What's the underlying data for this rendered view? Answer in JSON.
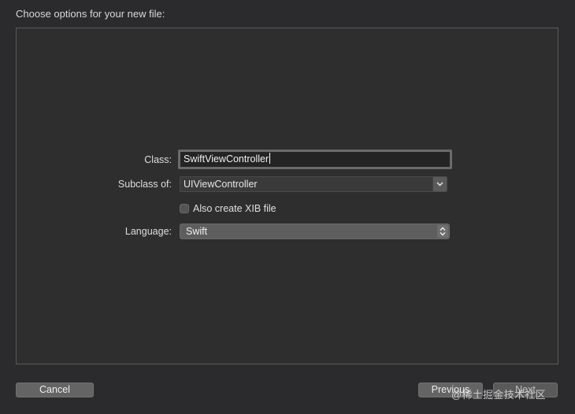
{
  "header": {
    "title": "Choose options for your new file:"
  },
  "form": {
    "class_label": "Class:",
    "class_value": "SwiftViewController",
    "subclass_label": "Subclass of:",
    "subclass_value": "UIViewController",
    "xib_checkbox_label": "Also create XIB file",
    "xib_checked": false,
    "language_label": "Language:",
    "language_value": "Swift"
  },
  "footer": {
    "cancel_label": "Cancel",
    "previous_label": "Previous",
    "next_label": "Next"
  },
  "watermark": "@稀土掘金技术社区",
  "icons": {
    "subclass_dropdown": "chevron-down-icon",
    "language_popup": "updown-chevrons-icon"
  }
}
